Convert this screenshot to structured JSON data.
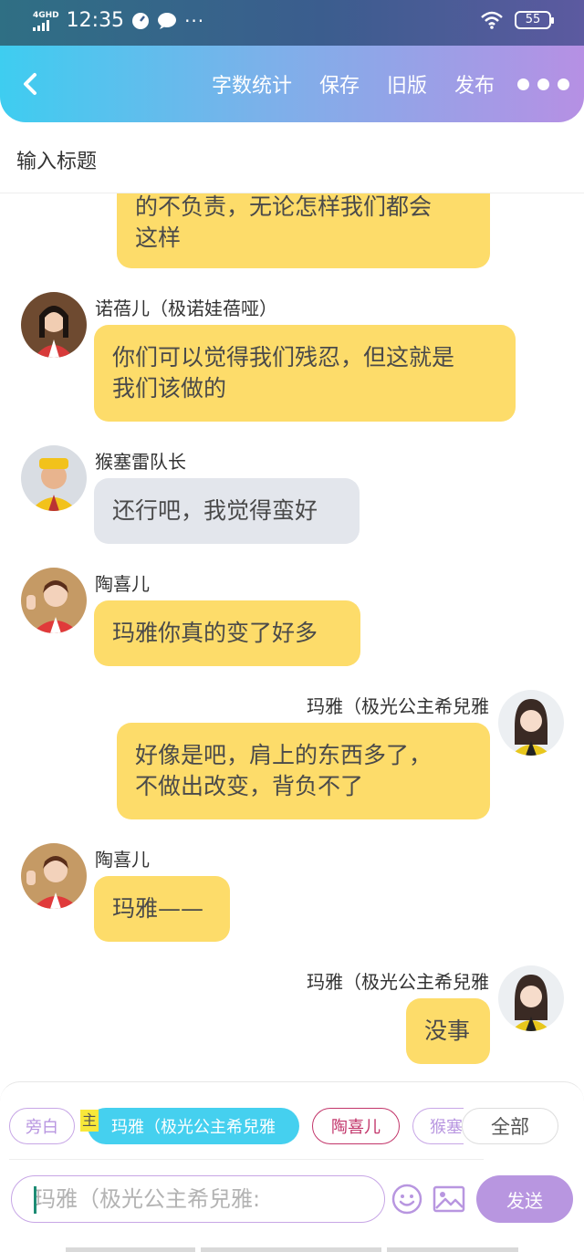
{
  "status_bar": {
    "network": "4GHD",
    "time": "12:35",
    "battery": "55"
  },
  "header": {
    "menu": [
      {
        "label": "字数统计"
      },
      {
        "label": "保存"
      },
      {
        "label": "旧版"
      },
      {
        "label": "发布"
      }
    ]
  },
  "title_input": {
    "placeholder": "输入标题"
  },
  "messages": [
    {
      "side": "left",
      "sender": "",
      "text_lines": [
        "的不负责，无论怎样我们都会",
        "这样"
      ],
      "color": "yellow"
    },
    {
      "side": "left",
      "sender": "诺蓓儿（极诺娃蓓哑）",
      "text_lines": [
        "你们可以觉得我们残忍，但这就是",
        "我们该做的"
      ],
      "color": "yellow"
    },
    {
      "side": "left",
      "sender": "猴塞雷队长",
      "text_lines": [
        "还行吧，我觉得蛮好"
      ],
      "color": "grey"
    },
    {
      "side": "left",
      "sender": "陶喜儿",
      "text_lines": [
        "玛雅你真的变了好多"
      ],
      "color": "yellow"
    },
    {
      "side": "right",
      "sender": "玛雅（极光公主希兒雅",
      "text_lines": [
        "好像是吧，肩上的东西多了，",
        "不做出改变，背负不了"
      ],
      "color": "yellow"
    },
    {
      "side": "left",
      "sender": "陶喜儿",
      "text_lines": [
        "玛雅——"
      ],
      "color": "yellow"
    },
    {
      "side": "right",
      "sender": "玛雅（极光公主希兒雅",
      "text_lines": [
        "没事"
      ],
      "color": "yellow"
    }
  ],
  "role_bar": {
    "main_tag": "主",
    "roles": [
      {
        "label": "旁白"
      },
      {
        "label": "玛雅（极光公主希兒雅"
      },
      {
        "label": "陶喜儿"
      },
      {
        "label": "猴塞"
      }
    ],
    "all_label": "全部"
  },
  "composer": {
    "placeholder": "玛雅（极光公主希兒雅:",
    "send_label": "发送"
  },
  "colors": {
    "bubble_yellow": "#fddc6a",
    "bubble_grey": "#e3e6ec",
    "accent_purple": "#b896e0",
    "accent_cyan": "#45d0ef"
  }
}
